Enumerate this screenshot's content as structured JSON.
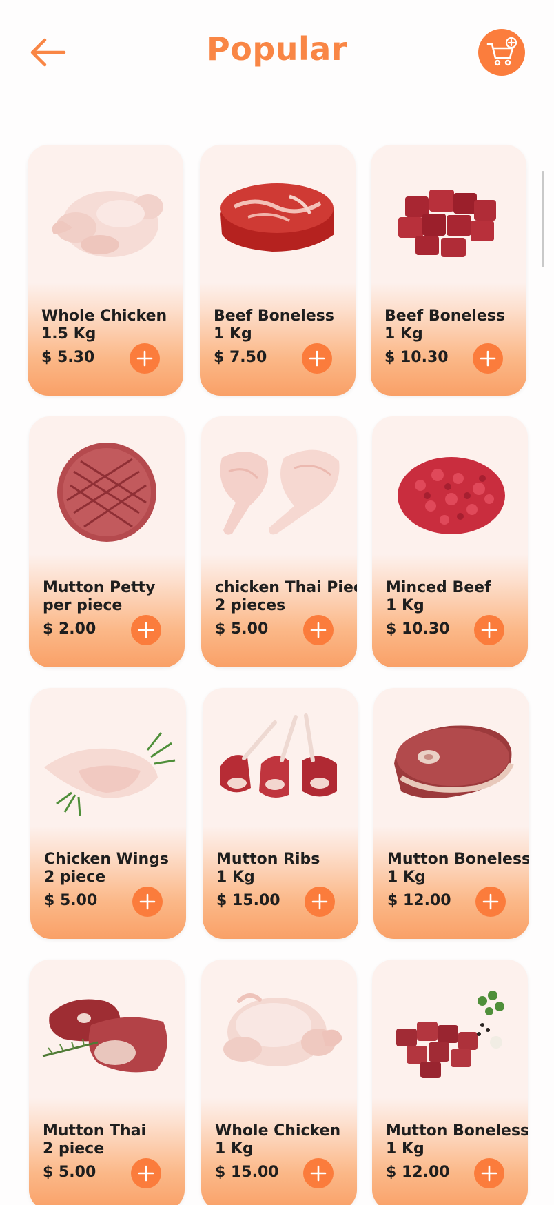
{
  "header": {
    "title": "Popular",
    "back_icon": "arrow-left-icon",
    "cart_icon": "cart-plus-icon"
  },
  "colors": {
    "accent": "#fb7c3c",
    "title": "#f98645",
    "card_top": "#fdf1ed",
    "card_bottom": "#f9a067"
  },
  "products": [
    {
      "name": "Whole Chicken",
      "weight": "1.5 Kg",
      "price": "$ 5.30",
      "image": "whole-chicken"
    },
    {
      "name": "Beef Boneless",
      "weight": "1 Kg",
      "price": "$ 7.50",
      "image": "beef-steak"
    },
    {
      "name": "Beef Boneless",
      "weight": "1 Kg",
      "price": "$ 10.30",
      "image": "beef-cubes"
    },
    {
      "name": "Mutton Petty",
      "weight": "per piece",
      "price": "$ 2.00",
      "image": "patty"
    },
    {
      "name": "chicken Thai Piece",
      "weight": "2 pieces",
      "price": "$ 5.00",
      "image": "chicken-legs"
    },
    {
      "name": "Minced Beef",
      "weight": "1 Kg",
      "price": "$ 10.30",
      "image": "minced-beef"
    },
    {
      "name": "Chicken Wings",
      "weight": "2 piece",
      "price": "$ 5.00",
      "image": "chicken-wings"
    },
    {
      "name": "Mutton Ribs",
      "weight": "1 Kg",
      "price": "$ 15.00",
      "image": "mutton-ribs"
    },
    {
      "name": "Mutton Boneless",
      "weight": "1 Kg",
      "price": "$ 12.00",
      "image": "mutton-steak"
    },
    {
      "name": "Mutton Thai",
      "weight": "2 piece",
      "price": "$ 5.00",
      "image": "mutton-leg"
    },
    {
      "name": "Whole Chicken",
      "weight": "1 Kg",
      "price": "$ 15.00",
      "image": "whole-chicken-2"
    },
    {
      "name": "Mutton Boneless",
      "weight": "1 Kg",
      "price": "$ 12.00",
      "image": "mutton-cubes"
    }
  ]
}
